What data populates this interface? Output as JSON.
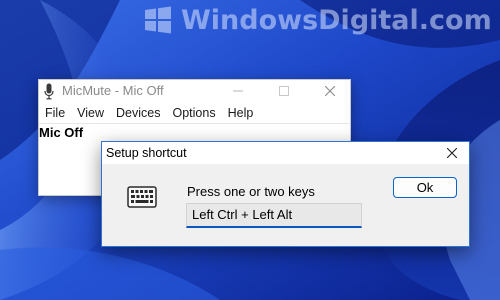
{
  "watermark": {
    "text": "WindowsDigital.com"
  },
  "main_window": {
    "title": "MicMute - Mic Off",
    "menu": [
      "File",
      "View",
      "Devices",
      "Options",
      "Help"
    ],
    "status": "Mic Off"
  },
  "dialog": {
    "title": "Setup shortcut",
    "prompt": "Press one or two keys",
    "shortcut_value": "Left Ctrl + Left Alt",
    "ok_label": "Ok"
  },
  "colors": {
    "wallpaper_base": "#1e4fd0",
    "dialog_accent": "#0a63c9",
    "field_underline": "#0c57c0"
  },
  "icons": [
    "windows-logo-icon",
    "microphone-icon",
    "minimize-icon",
    "maximize-icon",
    "close-icon",
    "keyboard-icon"
  ]
}
